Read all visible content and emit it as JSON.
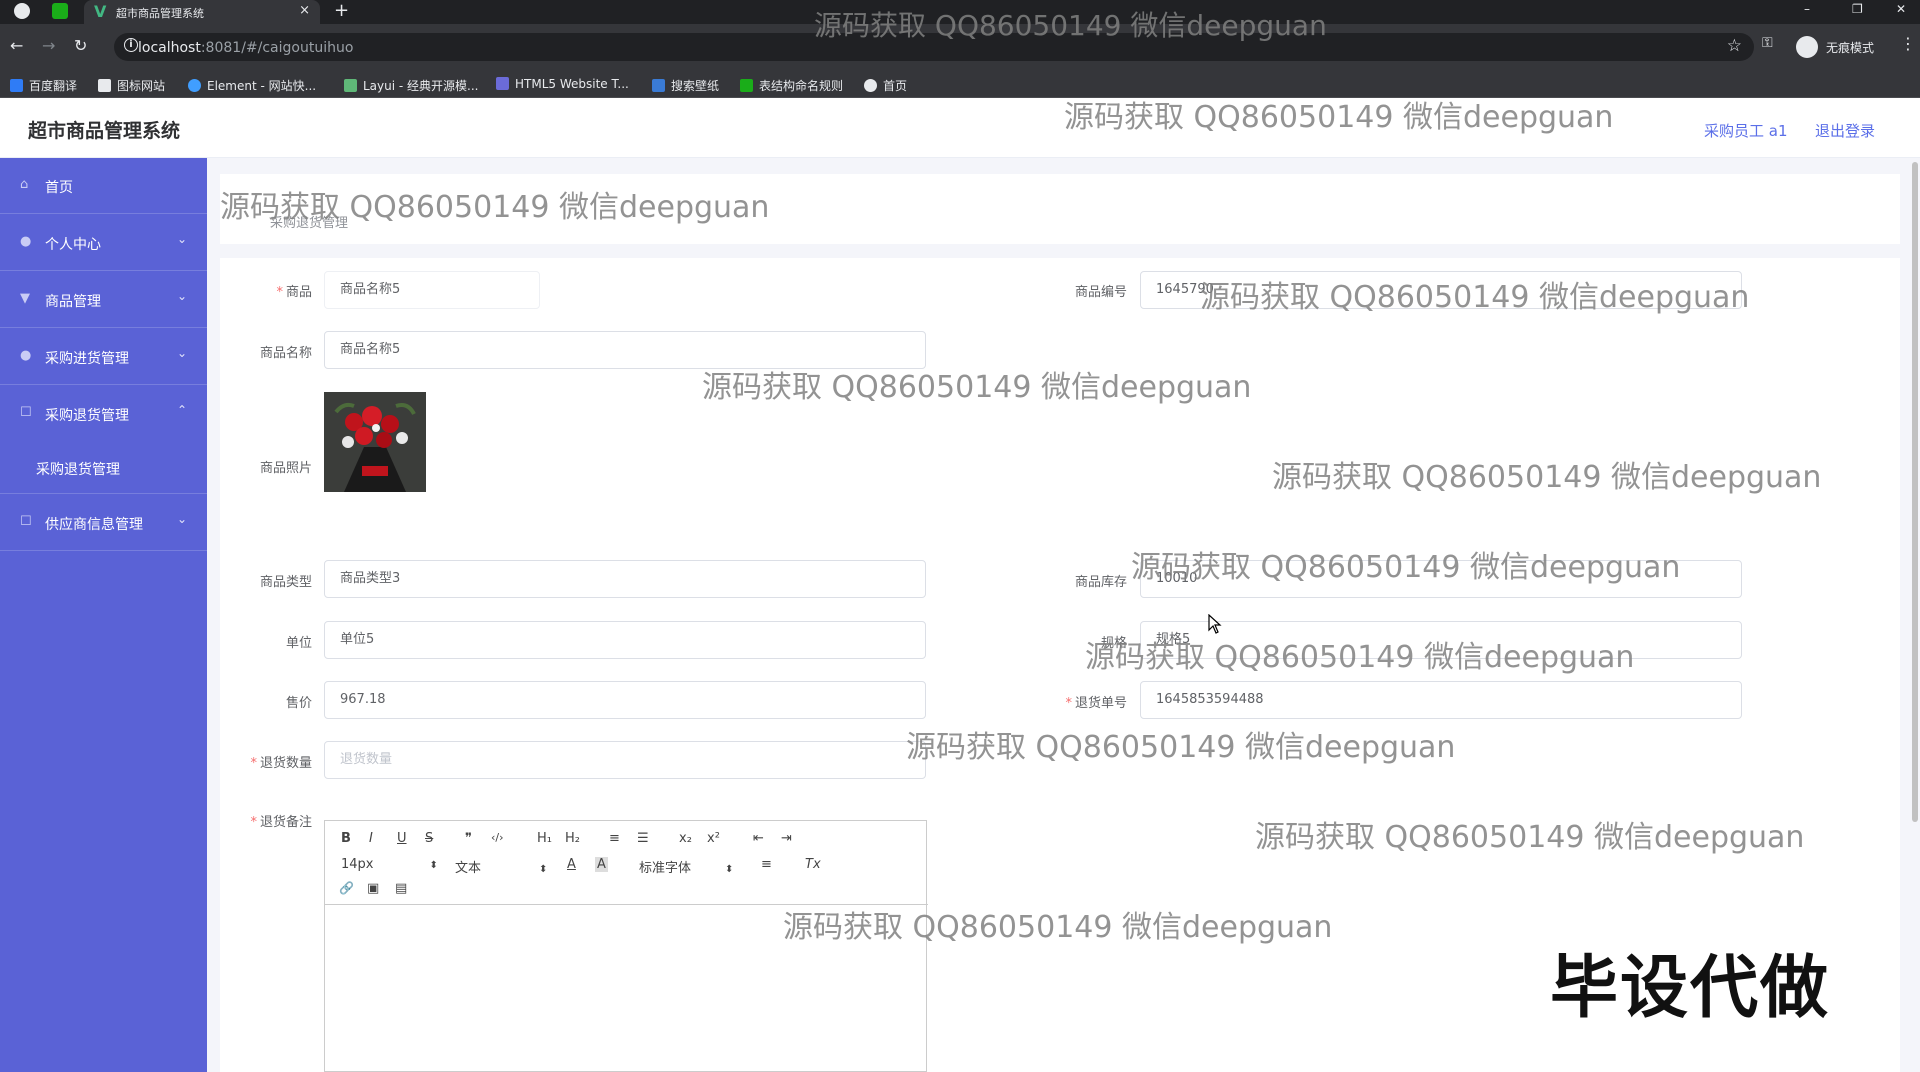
{
  "browser": {
    "tab_title": "超市商品管理系统",
    "tab_close": "×",
    "new_tab": "+",
    "url_host": "localhost",
    "url_rest": ":8081/#/caigoutuihuo",
    "incognito_label": "无痕模式",
    "window_controls": [
      "–",
      "❐",
      "✕"
    ],
    "bookmarks": [
      "百度翻译",
      "图标网站",
      "Element - 网站快...",
      "Layui - 经典开源模...",
      "HTML5 Website T...",
      "搜索壁纸",
      "表结构命名规则",
      "首页"
    ]
  },
  "header": {
    "title": "超市商品管理系统",
    "user": "采购员工 a1",
    "logout": "退出登录"
  },
  "sidebar": {
    "items": [
      {
        "label": "首页",
        "icon": "home-icon"
      },
      {
        "label": "个人中心",
        "icon": "user-icon"
      },
      {
        "label": "商品管理",
        "icon": "goods-icon"
      },
      {
        "label": "采购进货管理",
        "icon": "user-icon"
      },
      {
        "label": "采购退货管理",
        "icon": "list-icon"
      },
      {
        "label": "供应商信息管理",
        "icon": "list-icon"
      }
    ],
    "sub_item": "采购退货管理"
  },
  "breadcrumb": "采购退货管理",
  "form": {
    "goods_label": "商品",
    "goods_value": "商品名称5",
    "goods_no_label": "商品编号",
    "goods_no_value": "1645790",
    "goods_name_label": "商品名称",
    "goods_name_value": "商品名称5",
    "photo_label": "商品照片",
    "goods_type_label": "商品类型",
    "goods_type_value": "商品类型3",
    "stock_label": "商品库存",
    "stock_value": "10010",
    "unit_label": "单位",
    "unit_value": "单位5",
    "spec_label": "规格",
    "spec_value": "规格5",
    "price_label": "售价",
    "price_value": "967.18",
    "return_no_label": "退货单号",
    "return_no_value": "1645853594488",
    "qty_label": "退货数量",
    "qty_placeholder": "退货数量",
    "remark_label": "退货备注"
  },
  "editor": {
    "buttons_row1": [
      "B",
      "I",
      "U",
      "S",
      "❞",
      "‹/›",
      "H₁",
      "H₂",
      "≡",
      "☰",
      "x₂",
      "x²",
      "⇤",
      "⇥"
    ],
    "font_size": "14px",
    "text_style": "文本",
    "font_family": "标准字体",
    "buttons_row2": [
      "A",
      "A",
      "≡",
      "Tx"
    ],
    "buttons_row3": [
      "🔗",
      "▣",
      "▤"
    ]
  },
  "watermark": "源码获取 QQ86050149 微信deepguan",
  "stamp": "毕设代做"
}
